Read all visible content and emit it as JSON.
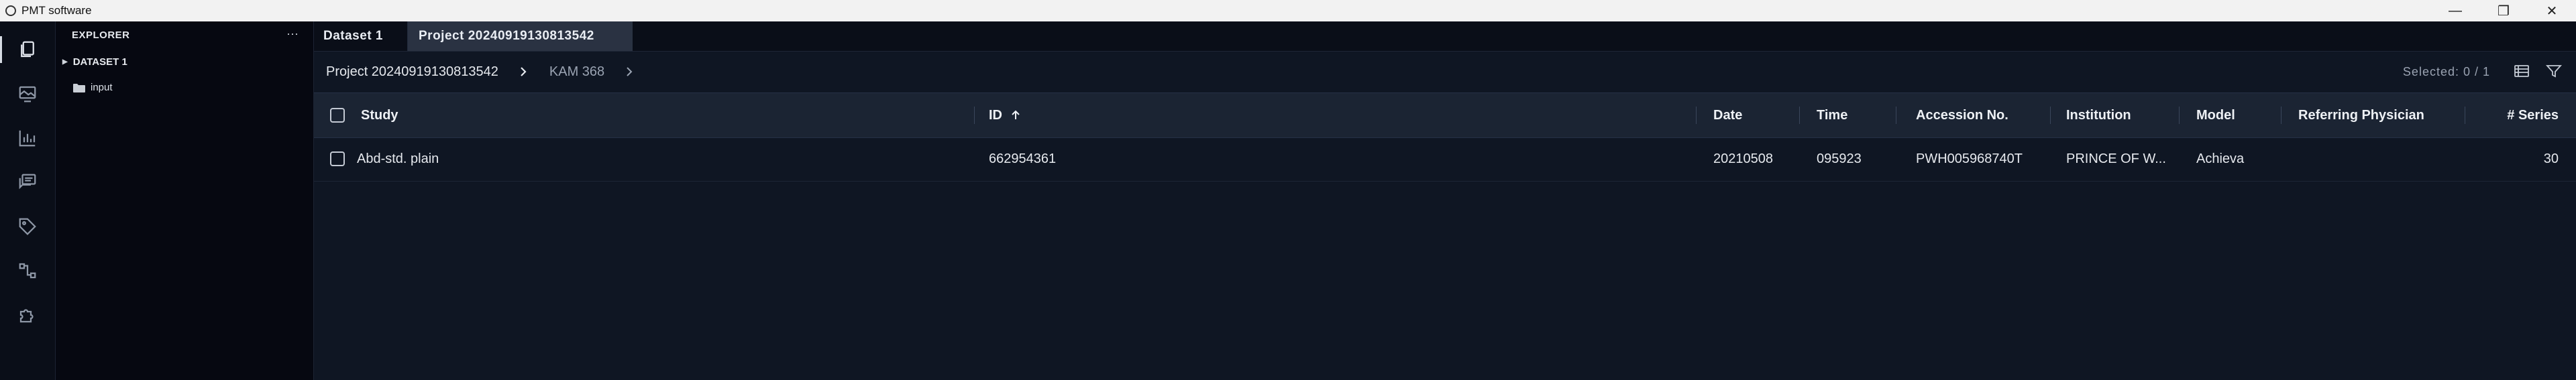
{
  "window": {
    "title": "PMT software",
    "controls": [
      "—",
      "❐",
      "✕"
    ]
  },
  "activity_bar": {
    "items": [
      {
        "name": "explorer-icon"
      },
      {
        "name": "viewer-icon"
      },
      {
        "name": "chart-icon"
      },
      {
        "name": "messages-icon"
      },
      {
        "name": "tag-icon"
      },
      {
        "name": "workflow-icon"
      },
      {
        "name": "plugin-icon"
      }
    ]
  },
  "explorer": {
    "header": "EXPLORER",
    "more": "···",
    "root": "DATASET 1",
    "child": "input"
  },
  "tabs": [
    {
      "label": "Dataset 1"
    },
    {
      "label": "Project 20240919130813542"
    }
  ],
  "breadcrumb": {
    "items": [
      "Project 20240919130813542",
      "KAM 368"
    ]
  },
  "toolbar": {
    "selected": "Selected: 0 / 1"
  },
  "table": {
    "columns": [
      "Study",
      "ID",
      "Date",
      "Time",
      "Accession No.",
      "Institution",
      "Model",
      "Referring Physician",
      "# Series"
    ],
    "sort": {
      "column": "ID",
      "direction": "ascending"
    },
    "rows": [
      {
        "study": "Abd-std. plain",
        "id": "662954361",
        "date": "20210508",
        "time": "095923",
        "accession": "PWH005968740T",
        "institution": "PRINCE OF W...",
        "model": "Achieva",
        "physician": "",
        "series": "30"
      }
    ]
  },
  "colors": {
    "background": "#0f1623",
    "sidebar": "#060811",
    "header_row": "#1b2433",
    "active_tab": "#2a3242"
  }
}
